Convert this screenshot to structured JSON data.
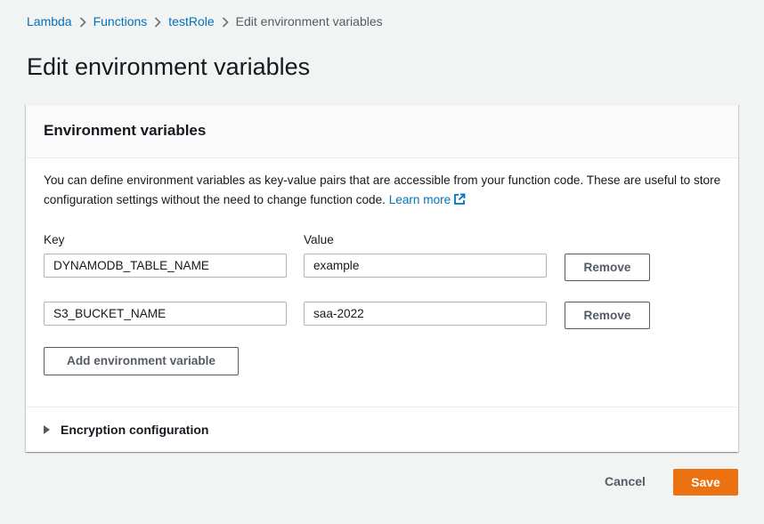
{
  "breadcrumb": {
    "items": [
      {
        "label": "Lambda"
      },
      {
        "label": "Functions"
      },
      {
        "label": "testRole"
      },
      {
        "label": "Edit environment variables"
      }
    ]
  },
  "page": {
    "title": "Edit environment variables"
  },
  "panel": {
    "title": "Environment variables",
    "description": "You can define environment variables as key-value pairs that are accessible from your function code. These are useful to store configuration settings without the need to change function code.",
    "learn_more": "Learn more",
    "key_label": "Key",
    "value_label": "Value",
    "rows": [
      {
        "key": "DYNAMODB_TABLE_NAME",
        "value": "example",
        "remove_label": "Remove"
      },
      {
        "key": "S3_BUCKET_NAME",
        "value": "saa-2022",
        "remove_label": "Remove"
      }
    ],
    "add_label": "Add environment variable",
    "encryption_label": "Encryption configuration"
  },
  "footer": {
    "cancel_label": "Cancel",
    "save_label": "Save"
  },
  "colors": {
    "link": "#0073bb",
    "primary": "#ec7211",
    "background": "#f2f3f3"
  },
  "icons": {
    "breadcrumb_separator": "chevron-right-icon",
    "learn_more": "external-link-icon",
    "expander": "caret-right-icon"
  }
}
